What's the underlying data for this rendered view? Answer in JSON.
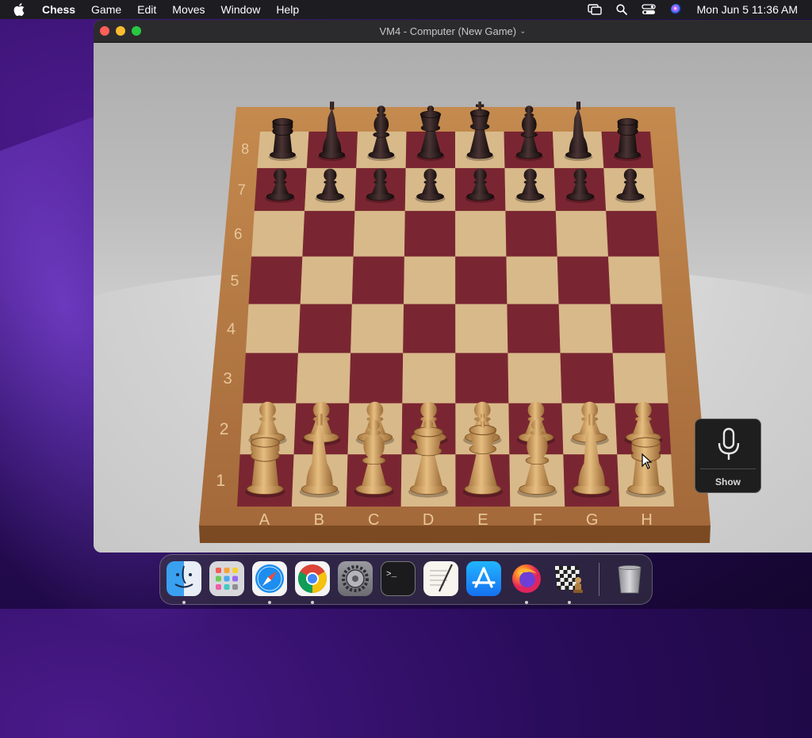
{
  "menubar": {
    "app_name": "Chess",
    "menus": [
      "Game",
      "Edit",
      "Moves",
      "Window",
      "Help"
    ],
    "clock": "Mon Jun 5  11:36 AM"
  },
  "window": {
    "title": "VM4 - Computer  (New Game)"
  },
  "board": {
    "ranks": [
      "8",
      "7",
      "6",
      "5",
      "4",
      "3",
      "2",
      "1"
    ],
    "files": [
      "A",
      "B",
      "C",
      "D",
      "E",
      "F",
      "G",
      "H"
    ],
    "position": {
      "rank8": [
        "r",
        "n",
        "b",
        "q",
        "k",
        "b",
        "n",
        "r"
      ],
      "rank7": [
        "p",
        "p",
        "p",
        "p",
        "p",
        "p",
        "p",
        "p"
      ],
      "rank2": [
        "P",
        "P",
        "P",
        "P",
        "P",
        "P",
        "P",
        "P"
      ],
      "rank1": [
        "R",
        "N",
        "B",
        "Q",
        "K",
        "B",
        "N",
        "R"
      ]
    },
    "colors": {
      "light_square": "#d8b98a",
      "dark_square": "#7a2632",
      "frame": "#a9733f",
      "black_pieces": "#2a1c1c",
      "white_pieces": "#d2a465"
    }
  },
  "voice_control": {
    "label": "Show",
    "icon": "microphone-icon"
  },
  "dock": {
    "items": [
      {
        "name": "Finder",
        "icon": "finder-icon"
      },
      {
        "name": "Launchpad",
        "icon": "launchpad-icon"
      },
      {
        "name": "Safari",
        "icon": "safari-icon"
      },
      {
        "name": "Chrome",
        "icon": "chrome-icon"
      },
      {
        "name": "System Settings",
        "icon": "system-settings-icon"
      },
      {
        "name": "Terminal",
        "icon": "terminal-icon"
      },
      {
        "name": "TextEdit",
        "icon": "textedit-icon"
      },
      {
        "name": "App Store",
        "icon": "app-store-icon"
      },
      {
        "name": "Firefox",
        "icon": "firefox-icon"
      },
      {
        "name": "Chess",
        "icon": "chess-icon"
      },
      {
        "name": "Trash",
        "icon": "trash-icon"
      }
    ]
  }
}
